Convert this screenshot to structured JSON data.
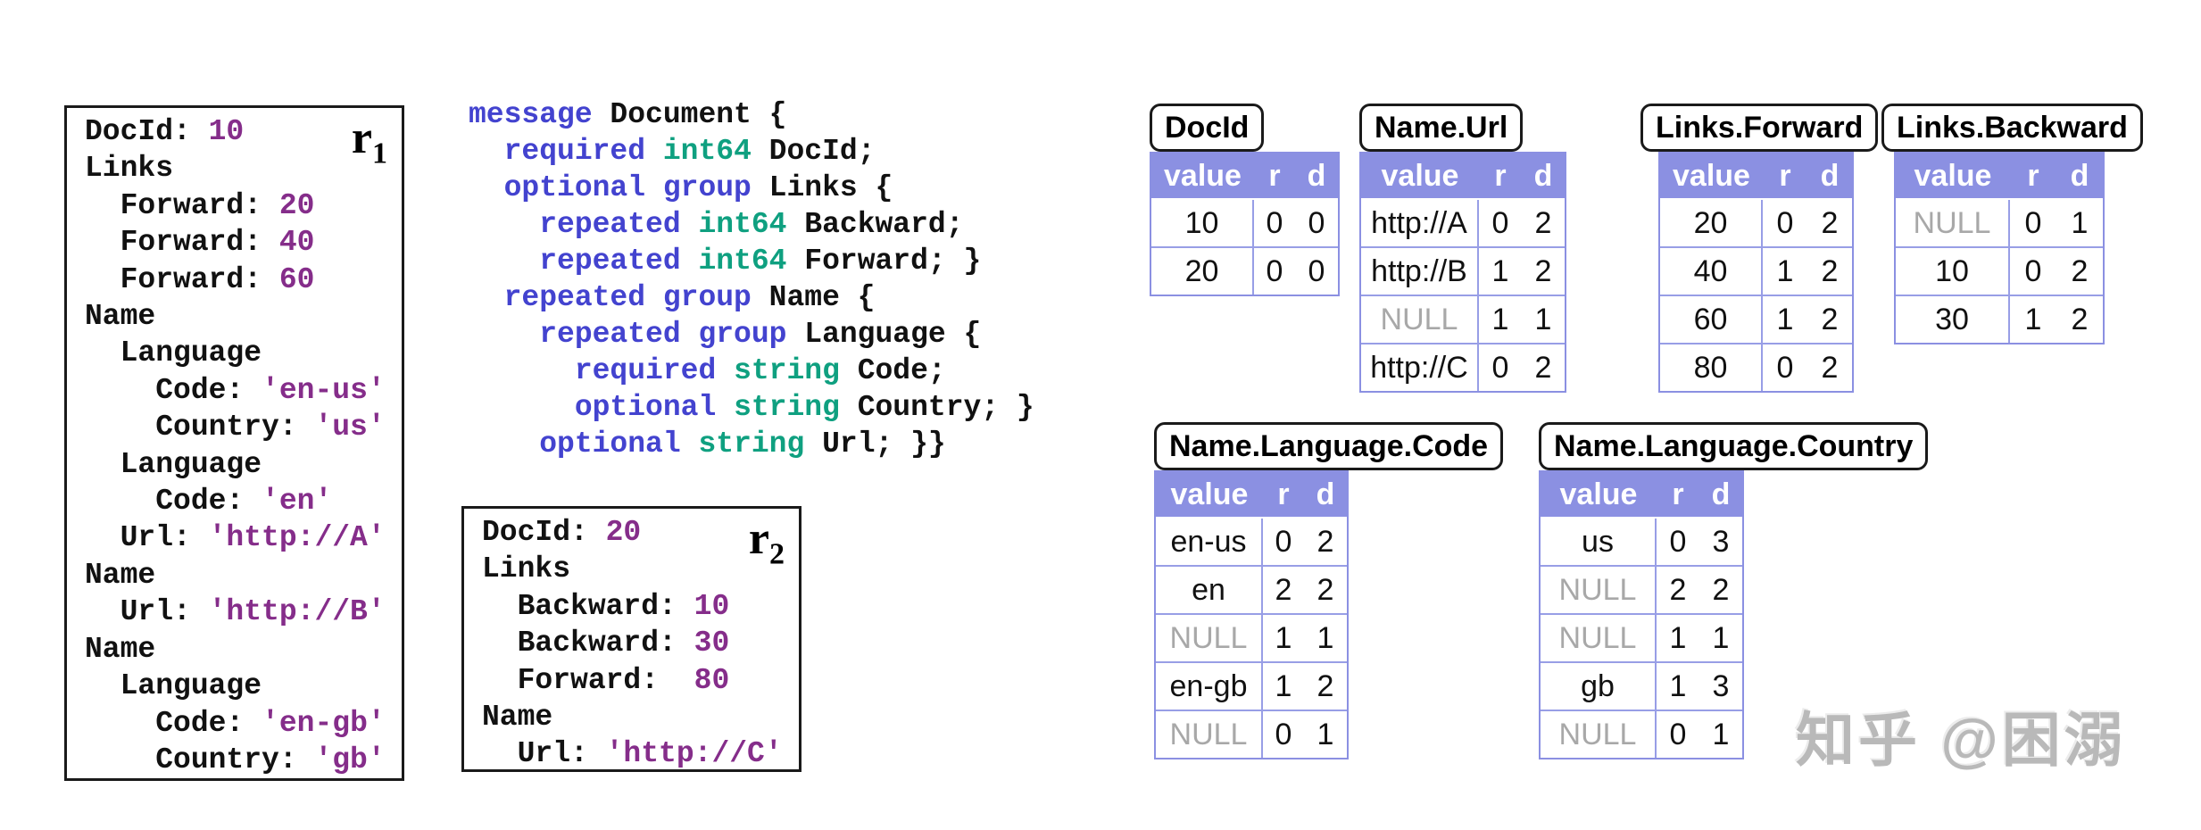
{
  "palette": {
    "value_purple": "#852d8a",
    "keyword_blue": "#4343cf",
    "type_teal": "#0fa080",
    "header_bg": "#8b90e2",
    "table_border": "#989ee6",
    "null_gray": "#a8a8a8",
    "watermark_gray": "#b9b9b9"
  },
  "records": [
    {
      "label": "r",
      "label_sub": "1",
      "lines": [
        [
          [
            "n",
            "DocId: "
          ],
          [
            "v",
            "10"
          ]
        ],
        [
          [
            "n",
            "Links"
          ]
        ],
        [
          [
            "n",
            "  Forward: "
          ],
          [
            "v",
            "20"
          ]
        ],
        [
          [
            "n",
            "  Forward: "
          ],
          [
            "v",
            "40"
          ]
        ],
        [
          [
            "n",
            "  Forward: "
          ],
          [
            "v",
            "60"
          ]
        ],
        [
          [
            "n",
            "Name"
          ]
        ],
        [
          [
            "n",
            "  Language"
          ]
        ],
        [
          [
            "n",
            "    Code: "
          ],
          [
            "v",
            "'en-us'"
          ]
        ],
        [
          [
            "n",
            "    Country: "
          ],
          [
            "v",
            "'us'"
          ]
        ],
        [
          [
            "n",
            "  Language"
          ]
        ],
        [
          [
            "n",
            "    Code: "
          ],
          [
            "v",
            "'en'"
          ]
        ],
        [
          [
            "n",
            "  Url: "
          ],
          [
            "v",
            "'http://A'"
          ]
        ],
        [
          [
            "n",
            "Name"
          ]
        ],
        [
          [
            "n",
            "  Url: "
          ],
          [
            "v",
            "'http://B'"
          ]
        ],
        [
          [
            "n",
            "Name"
          ]
        ],
        [
          [
            "n",
            "  Language"
          ]
        ],
        [
          [
            "n",
            "    Code: "
          ],
          [
            "v",
            "'en-gb'"
          ]
        ],
        [
          [
            "n",
            "    Country: "
          ],
          [
            "v",
            "'gb'"
          ]
        ]
      ]
    },
    {
      "label": "r",
      "label_sub": "2",
      "lines": [
        [
          [
            "n",
            "DocId: "
          ],
          [
            "v",
            "20"
          ]
        ],
        [
          [
            "n",
            "Links"
          ]
        ],
        [
          [
            "n",
            "  Backward: "
          ],
          [
            "v",
            "10"
          ]
        ],
        [
          [
            "n",
            "  Backward: "
          ],
          [
            "v",
            "30"
          ]
        ],
        [
          [
            "n",
            "  Forward:  "
          ],
          [
            "v",
            "80"
          ]
        ],
        [
          [
            "n",
            "Name"
          ]
        ],
        [
          [
            "n",
            "  Url: "
          ],
          [
            "v",
            "'http://C'"
          ]
        ]
      ]
    }
  ],
  "schema": {
    "lines": [
      [
        [
          "kw",
          "message"
        ],
        [
          "n",
          " Document {"
        ]
      ],
      [
        [
          "n",
          "  "
        ],
        [
          "kw",
          "required"
        ],
        [
          "ty",
          " int64"
        ],
        [
          "n",
          " DocId;"
        ]
      ],
      [
        [
          "n",
          "  "
        ],
        [
          "kw",
          "optional group"
        ],
        [
          "n",
          " Links {"
        ]
      ],
      [
        [
          "n",
          "    "
        ],
        [
          "kw",
          "repeated"
        ],
        [
          "ty",
          " int64"
        ],
        [
          "n",
          " Backward;"
        ]
      ],
      [
        [
          "n",
          "    "
        ],
        [
          "kw",
          "repeated"
        ],
        [
          "ty",
          " int64"
        ],
        [
          "n",
          " Forward; }"
        ]
      ],
      [
        [
          "n",
          "  "
        ],
        [
          "kw",
          "repeated group"
        ],
        [
          "n",
          " Name {"
        ]
      ],
      [
        [
          "n",
          "    "
        ],
        [
          "kw",
          "repeated group"
        ],
        [
          "n",
          " Language {"
        ]
      ],
      [
        [
          "n",
          "      "
        ],
        [
          "kw",
          "required"
        ],
        [
          "ty",
          " string"
        ],
        [
          "n",
          " Code;"
        ]
      ],
      [
        [
          "n",
          "      "
        ],
        [
          "kw",
          "optional"
        ],
        [
          "ty",
          " string"
        ],
        [
          "n",
          " Country; }"
        ]
      ],
      [
        [
          "n",
          "    "
        ],
        [
          "kw",
          "optional"
        ],
        [
          "ty",
          " string"
        ],
        [
          "n",
          " Url; }}"
        ]
      ]
    ]
  },
  "table_columns": [
    "value",
    "r",
    "d"
  ],
  "tables": [
    {
      "title": "DocId",
      "rows": [
        [
          "10",
          "0",
          "0"
        ],
        [
          "20",
          "0",
          "0"
        ]
      ]
    },
    {
      "title": "Name.Url",
      "rows": [
        [
          "http://A",
          "0",
          "2"
        ],
        [
          "http://B",
          "1",
          "2"
        ],
        [
          "NULL",
          "1",
          "1"
        ],
        [
          "http://C",
          "0",
          "2"
        ]
      ]
    },
    {
      "title": "Links.Forward",
      "rows": [
        [
          "20",
          "0",
          "2"
        ],
        [
          "40",
          "1",
          "2"
        ],
        [
          "60",
          "1",
          "2"
        ],
        [
          "80",
          "0",
          "2"
        ]
      ]
    },
    {
      "title": "Links.Backward",
      "rows": [
        [
          "NULL",
          "0",
          "1"
        ],
        [
          "10",
          "0",
          "2"
        ],
        [
          "30",
          "1",
          "2"
        ]
      ]
    },
    {
      "title": "Name.Language.Code",
      "rows": [
        [
          "en-us",
          "0",
          "2"
        ],
        [
          "en",
          "2",
          "2"
        ],
        [
          "NULL",
          "1",
          "1"
        ],
        [
          "en-gb",
          "1",
          "2"
        ],
        [
          "NULL",
          "0",
          "1"
        ]
      ]
    },
    {
      "title": "Name.Language.Country",
      "rows": [
        [
          "us",
          "0",
          "3"
        ],
        [
          "NULL",
          "2",
          "2"
        ],
        [
          "NULL",
          "1",
          "1"
        ],
        [
          "gb",
          "1",
          "3"
        ],
        [
          "NULL",
          "0",
          "1"
        ]
      ]
    }
  ],
  "watermark": {
    "text": "知乎 @困溺"
  }
}
